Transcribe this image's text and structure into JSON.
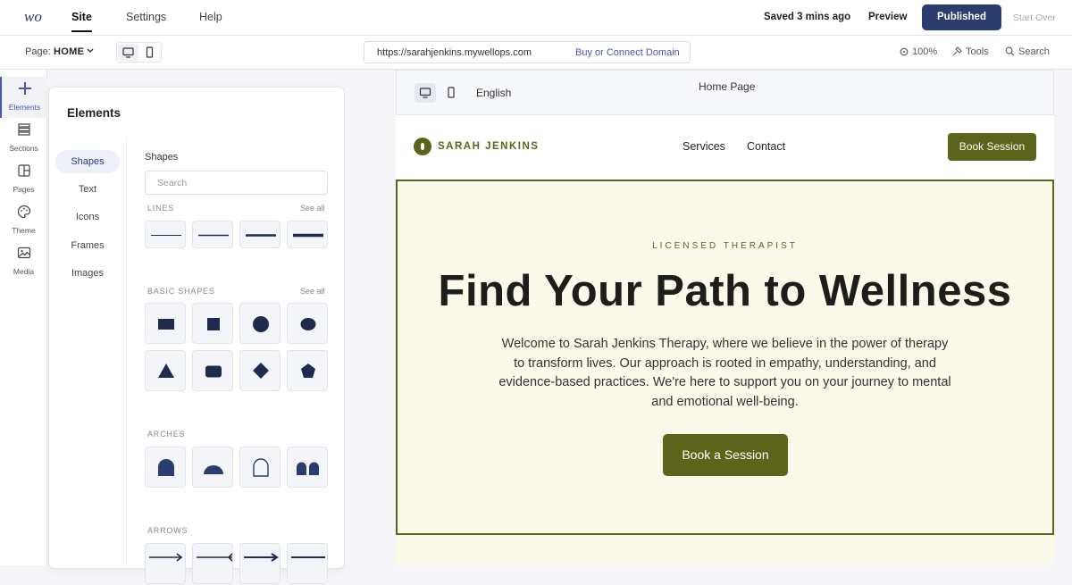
{
  "topbar": {
    "nav": [
      "Site",
      "Settings",
      "Help"
    ],
    "saved_status": "Saved 3 mins ago",
    "preview_label": "Preview",
    "published_label": "Published",
    "start_over_label": "Start Over"
  },
  "subbar": {
    "page_label": "Page:",
    "page_name": "HOME",
    "url": "https://sarahjenkins.mywellops.com",
    "domain_link": "Buy or Connect Domain",
    "zoom": "100%",
    "tools_label": "Tools",
    "search_label": "Search"
  },
  "rail": {
    "items": [
      {
        "label": "Elements",
        "icon": "plus-icon"
      },
      {
        "label": "Sections",
        "icon": "sections-icon"
      },
      {
        "label": "Pages",
        "icon": "pages-icon"
      },
      {
        "label": "Theme",
        "icon": "palette-icon"
      },
      {
        "label": "Media",
        "icon": "image-icon"
      }
    ]
  },
  "panel": {
    "title": "Elements",
    "categories": [
      "Shapes",
      "Text",
      "Icons",
      "Frames",
      "Images"
    ],
    "shapes_title": "Shapes",
    "search_placeholder": "Search",
    "sections": [
      {
        "title": "LINES",
        "see_all": "See all"
      },
      {
        "title": "BASIC SHAPES",
        "see_all": "See all"
      },
      {
        "title": "ARCHES"
      },
      {
        "title": "ARROWS"
      }
    ]
  },
  "page_header": {
    "language": "English",
    "page_title": "Home Page"
  },
  "site": {
    "brand": "SARAH JENKINS",
    "nav": [
      "Services",
      "Contact"
    ],
    "book_button": "Book Session",
    "hero": {
      "eyebrow": "LICENSED THERAPIST",
      "title": "Find Your Path to Wellness",
      "body": "Welcome to Sarah Jenkins Therapy, where we believe in the power of therapy to transform lives. Our approach is rooted in empathy, understanding, and evidence-based practices. We're here to support you on your journey to mental and emotional well-being.",
      "cta": "Book a Session"
    }
  },
  "colors": {
    "brand_green": "#5c641c",
    "published_blue": "#2a3d6e",
    "hero_bg": "#fbf9e9",
    "shape_fill": "#1f2b4d"
  }
}
